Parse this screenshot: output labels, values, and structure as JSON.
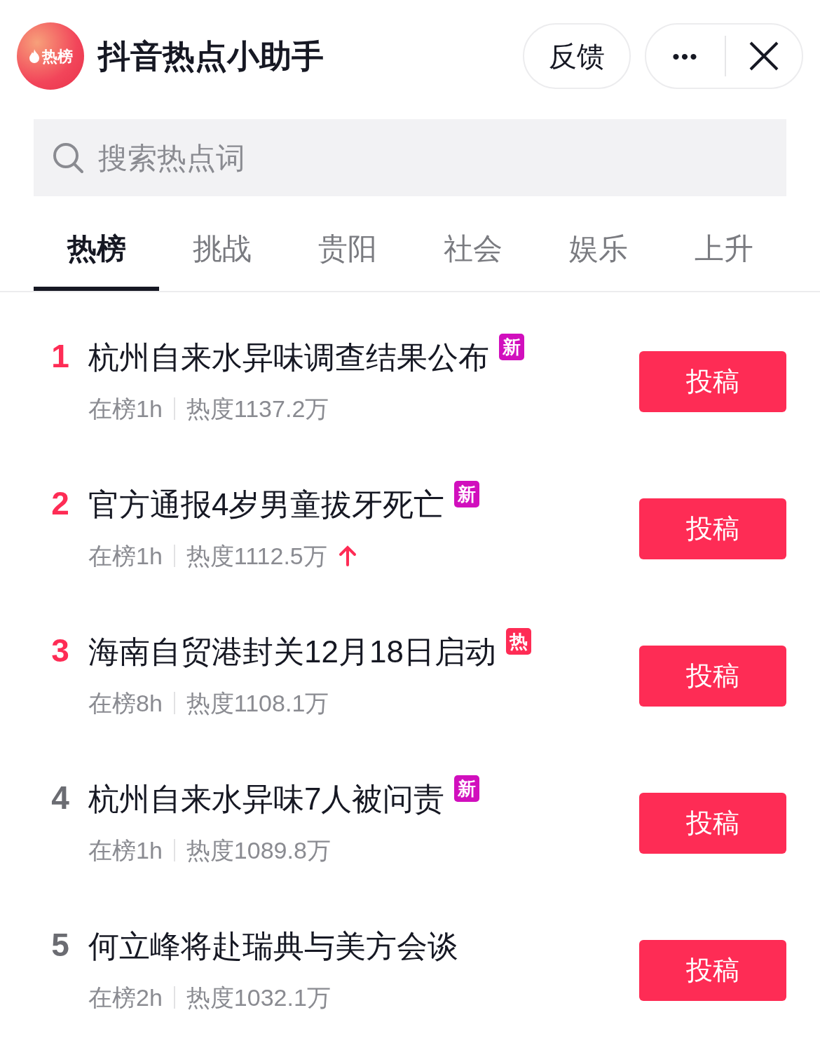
{
  "header": {
    "logo_text": "热榜",
    "title": "抖音热点小助手",
    "feedback_button": "反馈",
    "more_button": "•••"
  },
  "search": {
    "placeholder": "搜索热点词"
  },
  "tabs": [
    {
      "label": "热榜",
      "selected": true
    },
    {
      "label": "挑战",
      "selected": false
    },
    {
      "label": "贵阳",
      "selected": false
    },
    {
      "label": "社会",
      "selected": false
    },
    {
      "label": "娱乐",
      "selected": false
    },
    {
      "label": "上升",
      "selected": false
    }
  ],
  "items": [
    {
      "rank": "1",
      "top": true,
      "title": "杭州自来水异味调查结果公布",
      "badge": {
        "kind": "new",
        "text": "新"
      },
      "time": "在榜1h",
      "heat": "热度1137.2万",
      "rising": false,
      "button": "投稿"
    },
    {
      "rank": "2",
      "top": true,
      "title": "官方通报4岁男童拔牙死亡",
      "badge": {
        "kind": "new",
        "text": "新"
      },
      "time": "在榜1h",
      "heat": "热度1112.5万",
      "rising": true,
      "button": "投稿"
    },
    {
      "rank": "3",
      "top": true,
      "title": "海南自贸港封关12月18日启动",
      "badge": {
        "kind": "hot",
        "text": "热"
      },
      "time": "在榜8h",
      "heat": "热度1108.1万",
      "rising": false,
      "button": "投稿"
    },
    {
      "rank": "4",
      "top": false,
      "title": "杭州自来水异味7人被问责",
      "badge": {
        "kind": "new",
        "text": "新"
      },
      "time": "在榜1h",
      "heat": "热度1089.8万",
      "rising": false,
      "button": "投稿"
    },
    {
      "rank": "5",
      "top": false,
      "title": "何立峰将赴瑞典与美方会谈",
      "time": "在榜2h",
      "heat": "热度1032.1万",
      "rising": false,
      "button": "投稿"
    }
  ]
}
